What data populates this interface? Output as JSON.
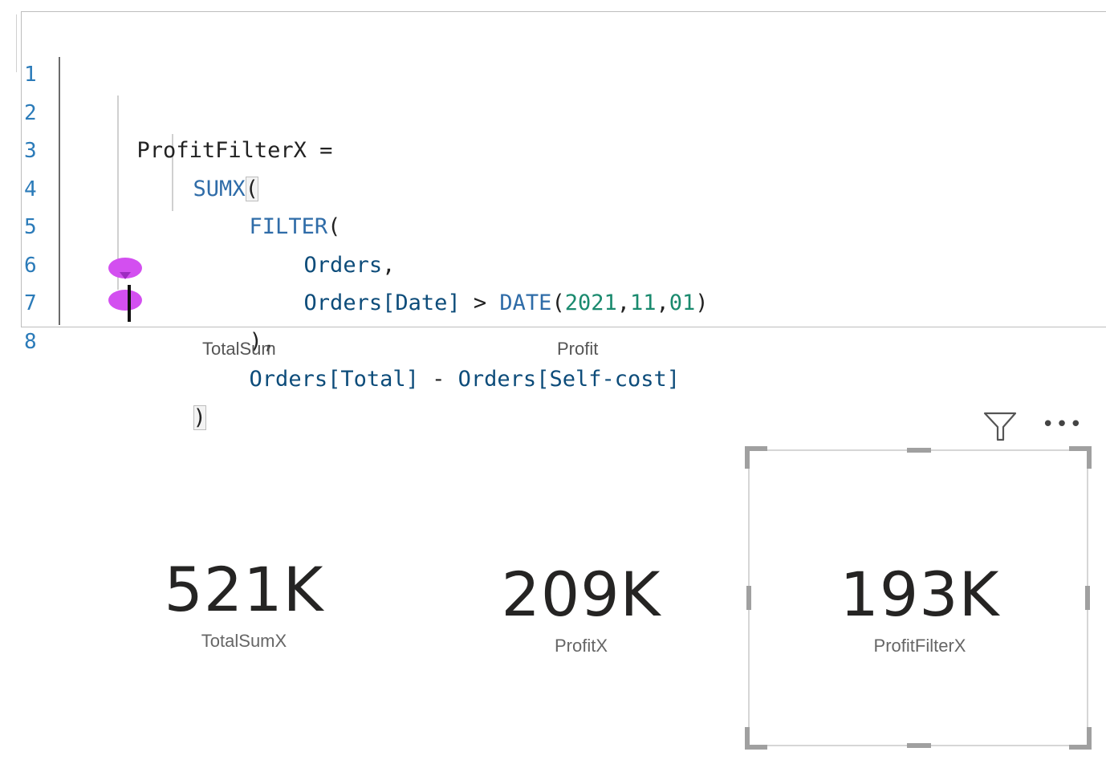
{
  "editor": {
    "lines": [
      {
        "num": "1",
        "parts": [
          "ProfitFilterX",
          " ="
        ]
      },
      {
        "num": "2",
        "parts": [
          "SUMX",
          "("
        ]
      },
      {
        "num": "3",
        "parts": [
          "FILTER",
          "("
        ]
      },
      {
        "num": "4",
        "parts": [
          "Orders",
          ","
        ]
      },
      {
        "num": "5",
        "parts": [
          "Orders[Date]",
          " > ",
          "DATE",
          "(",
          "2021",
          ",",
          "11",
          ",",
          "01",
          ")"
        ]
      },
      {
        "num": "6",
        "parts": [
          "),"
        ]
      },
      {
        "num": "7",
        "parts": [
          "Orders[Total]",
          " - ",
          "Orders[Self-cost]"
        ]
      },
      {
        "num": "8",
        "parts": [
          ")"
        ]
      }
    ]
  },
  "headers": {
    "left": "TotalSum",
    "middle": "Profit"
  },
  "cards": [
    {
      "value": "521K",
      "label": "TotalSumX"
    },
    {
      "value": "209K",
      "label": "ProfitX"
    },
    {
      "value": "193K",
      "label": "ProfitFilterX"
    }
  ],
  "icons": {
    "filter": "filter-icon",
    "more": "more-options-icon"
  },
  "colors": {
    "keyword": "#2f6ca8",
    "table": "#0d4c7a",
    "number": "#1a8a6e",
    "line_number": "#2b7bb9"
  }
}
